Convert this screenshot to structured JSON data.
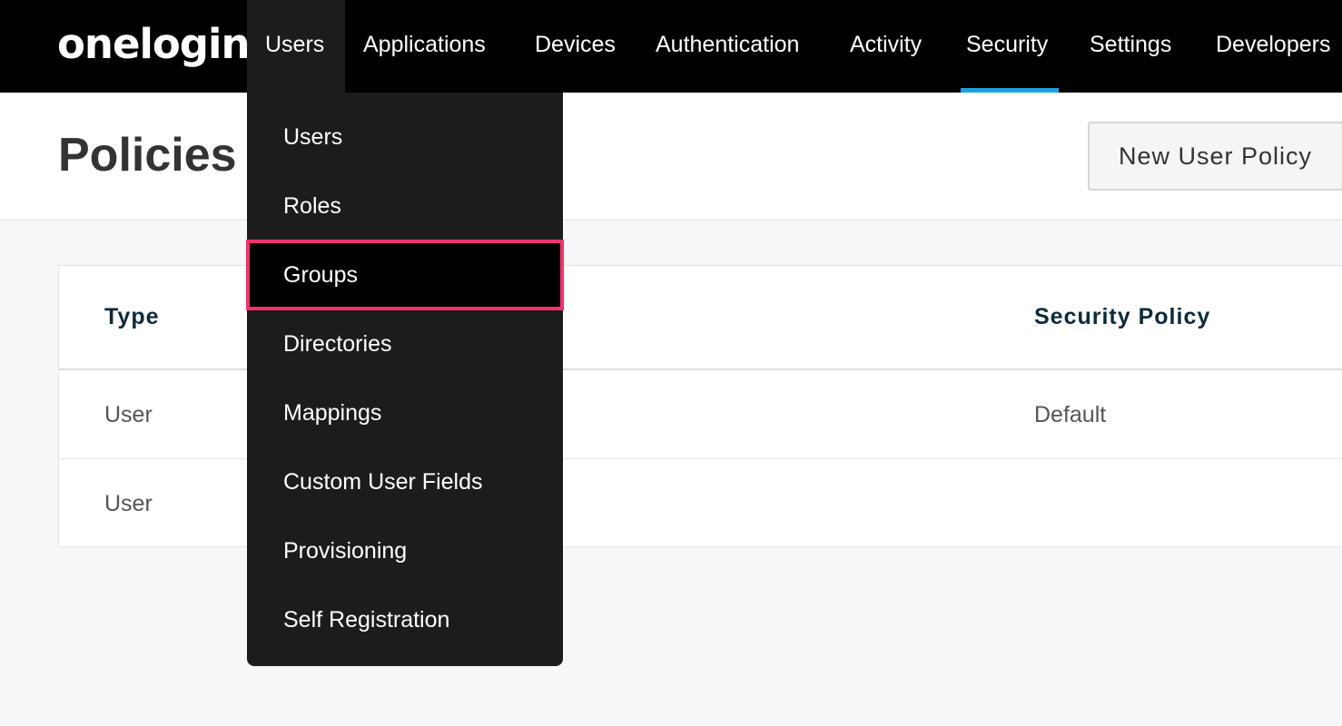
{
  "app": {
    "logo_text": "onelogin"
  },
  "nav": {
    "items": [
      {
        "label": "Users",
        "state": "open"
      },
      {
        "label": "Applications"
      },
      {
        "label": "Devices"
      },
      {
        "label": "Authentication"
      },
      {
        "label": "Activity"
      },
      {
        "label": "Security",
        "state": "active"
      },
      {
        "label": "Settings"
      },
      {
        "label": "Developers"
      }
    ],
    "active_underline_color": "#19a4d9"
  },
  "header": {
    "title": "Policies",
    "new_policy_label": "New User Policy"
  },
  "table": {
    "columns": [
      "Type",
      "Security Policy"
    ],
    "rows": [
      [
        "User",
        "Default"
      ],
      [
        "User",
        ""
      ]
    ]
  },
  "users_menu": {
    "items": [
      "Users",
      "Roles",
      "Groups",
      "Directories",
      "Mappings",
      "Custom User Fields",
      "Provisioning",
      "Self Registration"
    ],
    "highlighted": "Groups",
    "highlight_color": "#f0336d"
  }
}
